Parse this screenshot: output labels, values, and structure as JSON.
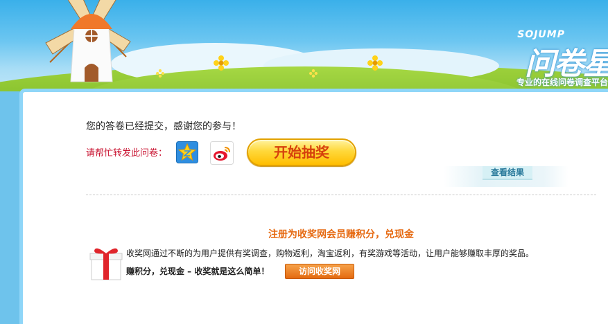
{
  "header": {
    "brand_en": "SOJUMP",
    "brand_cn": "问卷星",
    "tagline": "专业的在线问卷调查平台"
  },
  "main": {
    "thanks_message": "您的答卷已经提交，感谢您的参与！",
    "share_label": "请帮忙转发此问卷：",
    "share_icons": [
      "qq-zone-icon",
      "weibo-icon"
    ],
    "lottery_button": "开始抽奖",
    "result_button": "查看结果"
  },
  "promo": {
    "title": "注册为收奖网会员赚积分，兑现金",
    "description": "收奖网通过不断的为用户提供有奖调查，购物返利，淘宝返利，有奖游戏等活动，让用户能够赚取丰厚的奖品。",
    "slogan": "赚积分，兑现金 – 收奖就是这么简单！",
    "visit_button": "访问收奖网"
  },
  "colors": {
    "accent_orange": "#e66a12",
    "share_red": "#c8102e",
    "panel_border": "#8fd6f8",
    "sky": "#3ab0ea"
  }
}
